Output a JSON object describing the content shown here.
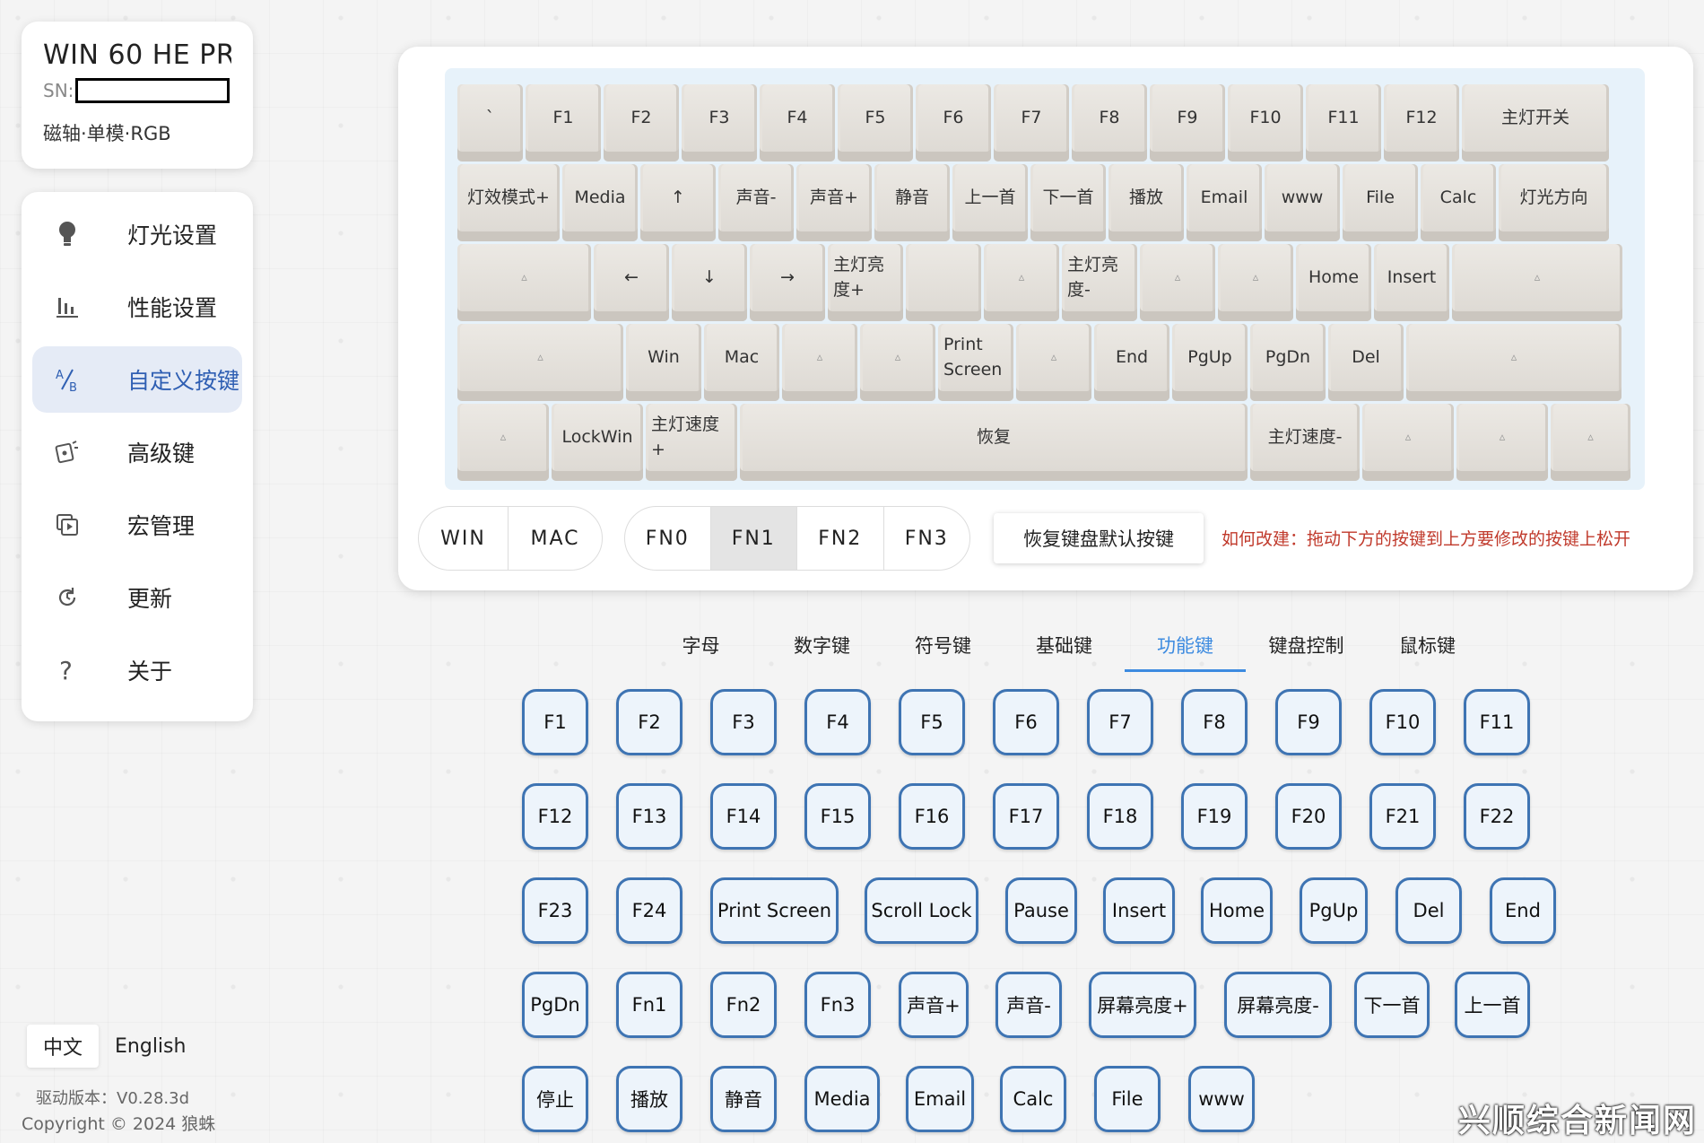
{
  "device": {
    "name": "WIN 60 HE PR(",
    "sn_label": "SN:",
    "tags": "磁轴·单模·RGB"
  },
  "nav": {
    "items": [
      {
        "label": "灯光设置",
        "icon": "lightbulb-icon",
        "active": false
      },
      {
        "label": "性能设置",
        "icon": "bar-chart-icon",
        "active": false
      },
      {
        "label": "自定义按键",
        "icon": "a-b-remap-icon",
        "active": true
      },
      {
        "label": "高级键",
        "icon": "advanced-key-icon",
        "active": false
      },
      {
        "label": "宏管理",
        "icon": "macro-icon",
        "active": false
      },
      {
        "label": "更新",
        "icon": "refresh-icon",
        "active": false
      },
      {
        "label": "关于",
        "icon": "question-icon",
        "active": false
      }
    ]
  },
  "language": {
    "zh": "中文",
    "en": "English",
    "selected": "中文"
  },
  "footer": {
    "version": "驱动版本：V0.28.3d",
    "copyright": "Copyright © 2024 狼蛛"
  },
  "keyboard": {
    "rows": [
      [
        "`",
        "F1",
        "F2",
        "F3",
        "F4",
        "F5",
        "F6",
        "F7",
        "F8",
        "F9",
        "F10",
        "F11",
        "F12",
        "主灯开关"
      ],
      [
        "灯效模式+",
        "Media",
        "↑",
        "声音-",
        "声音+",
        "静音",
        "上一首",
        "下一首",
        "播放",
        "Email",
        "www",
        "File",
        "Calc",
        "灯光方向"
      ],
      [
        "▵",
        "←",
        "↓",
        "→",
        "主灯亮度+",
        "",
        "▵",
        "主灯亮度-",
        "▵",
        "▵",
        "Home",
        "Insert",
        "▵"
      ],
      [
        "▵",
        "Win",
        "Mac",
        "▵",
        "▵",
        "Print Screen",
        "▵",
        "End",
        "PgUp",
        "PgDn",
        "Del",
        "▵"
      ],
      [
        "▵",
        "LockWin",
        "主灯速度+",
        "恢复",
        "主灯速度-",
        "▵",
        "▵",
        "▵"
      ]
    ]
  },
  "os_toggle": {
    "options": [
      "WIN",
      "MAC"
    ]
  },
  "layer_toggle": {
    "options": [
      "FN0",
      "FN1",
      "FN2",
      "FN3"
    ],
    "selected": "FN1"
  },
  "restore_button": "恢复键盘默认按键",
  "hint": "如何改建：拖动下方的按键到上方要修改的按键上松开",
  "tabs": {
    "items": [
      "字母",
      "数字键",
      "符号键",
      "基础键",
      "功能键",
      "键盘控制",
      "鼠标键"
    ],
    "selected": "功能键"
  },
  "palette": {
    "rows": [
      [
        "F1",
        "F2",
        "F3",
        "F4",
        "F5",
        "F6",
        "F7",
        "F8",
        "F9",
        "F10",
        "F11"
      ],
      [
        "F12",
        "F13",
        "F14",
        "F15",
        "F16",
        "F17",
        "F18",
        "F19",
        "F20",
        "F21",
        "F22"
      ],
      [
        "F23",
        "F24",
        "Print Screen",
        "Scroll Lock",
        "Pause",
        "Insert",
        "Home",
        "PgUp",
        "Del",
        "End"
      ],
      [
        "PgDn",
        "Fn1",
        "Fn2",
        "Fn3",
        "声音+",
        "声音-",
        "屏幕亮度+",
        "屏幕亮度-",
        "下一首",
        "上一首"
      ],
      [
        "停止",
        "播放",
        "静音",
        "Media",
        "Email",
        "Calc",
        "File",
        "www"
      ]
    ]
  },
  "watermark": "兴顺综合新闻网",
  "colors": {
    "accent": "#3d8be0",
    "hint": "#c0392b",
    "key_border": "#3e74b3",
    "active_nav_bg": "#e5ebf6"
  }
}
